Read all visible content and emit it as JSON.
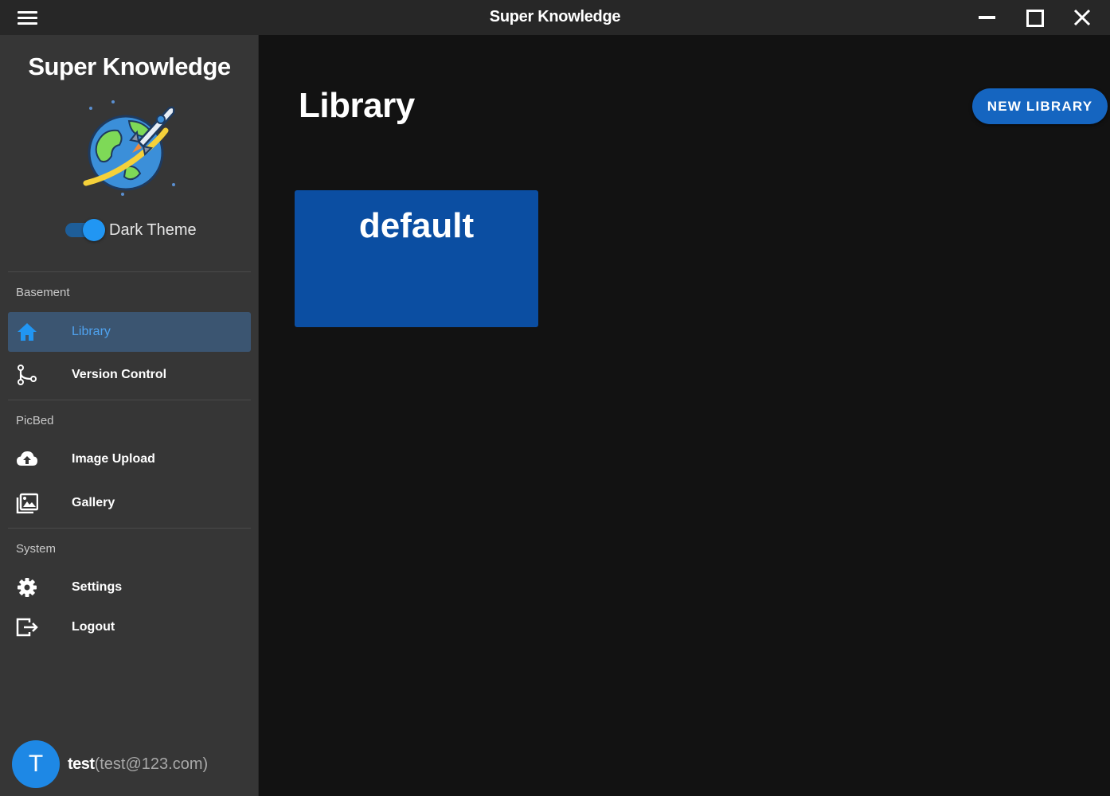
{
  "titlebar": {
    "title": "Super Knowledge",
    "menu_icon": "hamburger-menu-icon",
    "minimize_icon": "minimize-icon",
    "maximize_icon": "maximize-icon",
    "close_icon": "close-icon"
  },
  "sidebar": {
    "app_name": "Super Knowledge",
    "logo": "earth-rocket-logo",
    "theme_toggle": {
      "label": "Dark Theme",
      "on": true
    },
    "sections": [
      {
        "title": "Basement",
        "items": [
          {
            "label": "Library",
            "icon": "home-icon",
            "active": true
          },
          {
            "label": "Version Control",
            "icon": "source-branch-icon",
            "active": false
          }
        ]
      },
      {
        "title": "PicBed",
        "items": [
          {
            "label": "Image Upload",
            "icon": "cloud-upload-icon",
            "active": false
          },
          {
            "label": "Gallery",
            "icon": "image-multiple-icon",
            "active": false
          }
        ]
      },
      {
        "title": "System",
        "items": [
          {
            "label": "Settings",
            "icon": "gear-icon",
            "active": false
          },
          {
            "label": "Logout",
            "icon": "logout-icon",
            "active": false
          }
        ]
      }
    ],
    "user": {
      "initial": "T",
      "name": "test",
      "email": "(test@123.com)"
    }
  },
  "main": {
    "title": "Library",
    "new_button_label": "NEW LIBRARY",
    "libraries": [
      {
        "name": "default"
      }
    ]
  },
  "colors": {
    "accent": "#2196f3",
    "card": "#0b4ea2",
    "sidebar_bg": "#363636",
    "main_bg": "#121212",
    "titlebar_bg": "#272727"
  }
}
